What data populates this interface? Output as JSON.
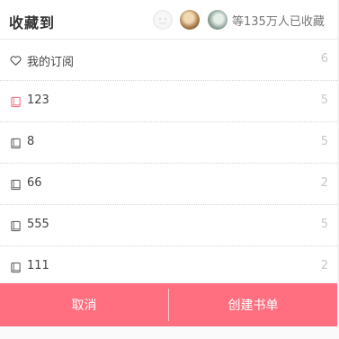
{
  "header": {
    "title": "收藏到",
    "collect_count_text": "等135万人已收藏"
  },
  "list": {
    "items": [
      {
        "label": "我的订阅",
        "count": "6",
        "icon": "heart-icon"
      },
      {
        "label": "123",
        "count": "5",
        "icon": "book-icon",
        "accent": "#ff6f7f"
      },
      {
        "label": "8",
        "count": "5",
        "icon": "book-icon"
      },
      {
        "label": "66",
        "count": "2",
        "icon": "book-icon"
      },
      {
        "label": "555",
        "count": "5",
        "icon": "book-icon"
      },
      {
        "label": "111",
        "count": "2",
        "icon": "book-icon"
      }
    ]
  },
  "footer": {
    "cancel_label": "取消",
    "create_label": "创建书单"
  },
  "colors": {
    "accent": "#ff6f7f"
  }
}
